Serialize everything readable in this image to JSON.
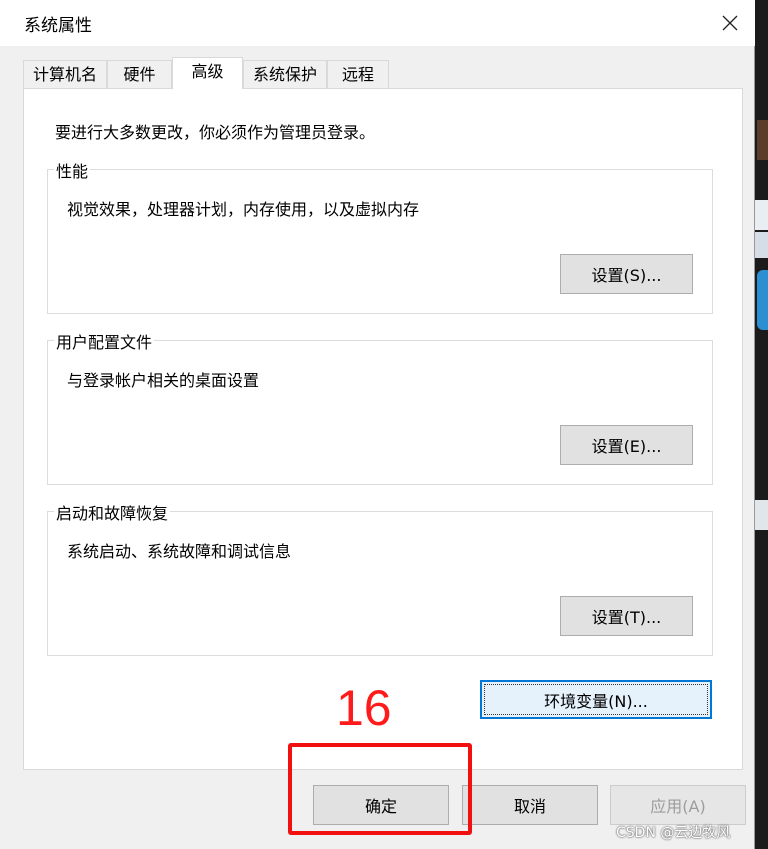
{
  "window": {
    "title": "系统属性",
    "close_glyph": "✕"
  },
  "tabs": [
    {
      "label": "计算机名",
      "active": false
    },
    {
      "label": "硬件",
      "active": false
    },
    {
      "label": "高级",
      "active": true
    },
    {
      "label": "系统保护",
      "active": false
    },
    {
      "label": "远程",
      "active": false
    }
  ],
  "panel": {
    "intro": "要进行大多数更改，你必须作为管理员登录。",
    "groups": [
      {
        "title": "性能",
        "description": "视觉效果，处理器计划，内存使用，以及虚拟内存",
        "button": "设置(S)..."
      },
      {
        "title": "用户配置文件",
        "description": "与登录帐户相关的桌面设置",
        "button": "设置(E)..."
      },
      {
        "title": "启动和故障恢复",
        "description": "系统启动、系统故障和调试信息",
        "button": "设置(T)..."
      }
    ],
    "env_button": "环境变量(N)..."
  },
  "footer": {
    "ok": "确定",
    "cancel": "取消",
    "apply": "应用(A)"
  },
  "annotation": {
    "number": "16",
    "color": "#f20f0f"
  },
  "watermark": "CSDN @云边牧风"
}
